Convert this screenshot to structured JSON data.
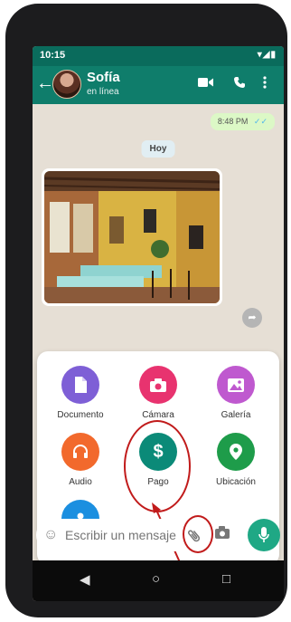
{
  "status_bar": {
    "time": "10:15",
    "icons": "▾◢▮"
  },
  "contact": {
    "name": "Sofía",
    "status": "en línea"
  },
  "chat": {
    "outgoing_time": "8:48 PM",
    "read_ticks": "✓✓",
    "date_chip": "Hoy"
  },
  "attach_options": [
    {
      "label": "Documento",
      "icon": "document-icon",
      "color": "#7e5fd6"
    },
    {
      "label": "Cámara",
      "icon": "camera-icon",
      "color": "#e8336f"
    },
    {
      "label": "Galería",
      "icon": "gallery-icon",
      "color": "#bf59cf"
    },
    {
      "label": "Audio",
      "icon": "headphones-icon",
      "color": "#f2692c"
    },
    {
      "label": "Pago",
      "icon": "dollar-icon",
      "color": "#0b8a78"
    },
    {
      "label": "Ubicación",
      "icon": "location-pin-icon",
      "color": "#1e9c4a"
    },
    {
      "label": "Contactar",
      "icon": "contact-person-icon",
      "color": "#1b8fe0"
    }
  ],
  "input": {
    "placeholder": "Escribir un mensaje"
  },
  "colors": {
    "header": "#0f7d6b",
    "statusbar": "#0a6b5c",
    "accent": "#1fa885",
    "annotation": "#c11b1b"
  },
  "nav_icons": [
    "back-triangle-icon",
    "home-circle-icon",
    "recents-square-icon"
  ]
}
